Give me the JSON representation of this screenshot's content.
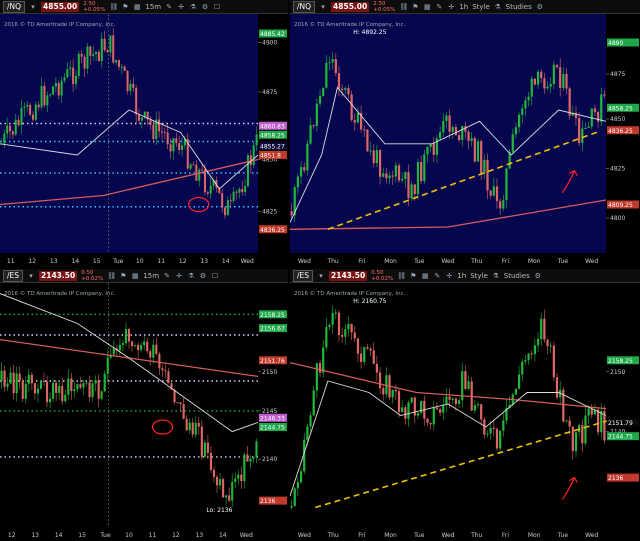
{
  "colors": {
    "bg_nq": "#06064f",
    "bg_es": "#000000",
    "bull": "#21b83a",
    "bear": "#e06666",
    "ma_red": "#d45c5c",
    "ma_white": "#dddddd",
    "trend": "#f0c000",
    "annot": "#ff2222"
  },
  "panels": [
    {
      "id": "p1",
      "symbol": "/NQ",
      "price": "4855.00",
      "pct_top": "2.50",
      "pct_bot": "+0.05%",
      "timeframe": "15m",
      "copyright": "2016 © TD Ameritrade IP Company, Inc.",
      "top_label": "",
      "xticks": [
        "11",
        "12",
        "13",
        "14",
        "15",
        "Tue",
        "10",
        "11",
        "12",
        "13",
        "14",
        "Wed"
      ],
      "price_tags": [
        "4885.42",
        "4860.83",
        "4858.25",
        "4855.27",
        "4851.8",
        "4836.25"
      ],
      "axis_ticks": [
        "4900",
        "4875",
        "4850",
        "4825"
      ]
    },
    {
      "id": "p2",
      "symbol": "/NQ",
      "price": "4855.00",
      "pct_top": "2.50",
      "pct_bot": "+0.05%",
      "timeframe": "1h",
      "style_label": "Style",
      "studies_label": "Studies",
      "copyright": "2016 © TD Ameritrade IP Company, Inc.",
      "top_label": "H: 4892.25",
      "xticks": [
        "Wed",
        "Thu",
        "Fri",
        "Mon",
        "Tue",
        "Wed",
        "Thu",
        "Fri",
        "Mon",
        "Tue",
        "Wed"
      ],
      "price_tags": [
        "4890",
        "4858.25",
        "4836.25",
        "4809.25"
      ],
      "axis_ticks": [
        "4875",
        "4850",
        "4825",
        "4800"
      ]
    },
    {
      "id": "p3",
      "symbol": "/ES",
      "price": "2143.50",
      "pct_top": "0.50",
      "pct_bot": "+0.02%",
      "timeframe": "15m",
      "copyright": "2016 © TD Ameritrade IP Company, Inc.",
      "top_label": "",
      "xticks": [
        "12",
        "13",
        "14",
        "15",
        "Tue",
        "10",
        "11",
        "12",
        "13",
        "14",
        "Wed"
      ],
      "price_tags": [
        "2158.25",
        "2156.67",
        "2151.76",
        "2146.33",
        "2144.75",
        "2136"
      ],
      "axis_ticks": [
        "2150",
        "2145",
        "2140"
      ],
      "low_label": "Lo: 2136"
    },
    {
      "id": "p4",
      "symbol": "/ES",
      "price": "2143.50",
      "pct_top": "0.50",
      "pct_bot": "+0.02%",
      "timeframe": "1h",
      "style_label": "Style",
      "studies_label": "Studies",
      "copyright": "2016 © TD Ameritrade IP Company, Inc.",
      "top_label": "H: 2160.75",
      "xticks": [
        "Wed",
        "Thu",
        "Fri",
        "Mon",
        "Tue",
        "Wed",
        "Thu",
        "Fri",
        "Mon",
        "Tue",
        "Wed"
      ],
      "price_tags": [
        "2158.25",
        "2151.79",
        "2144.75",
        "2136"
      ],
      "axis_ticks": [
        "2150",
        "2140"
      ]
    }
  ]
}
